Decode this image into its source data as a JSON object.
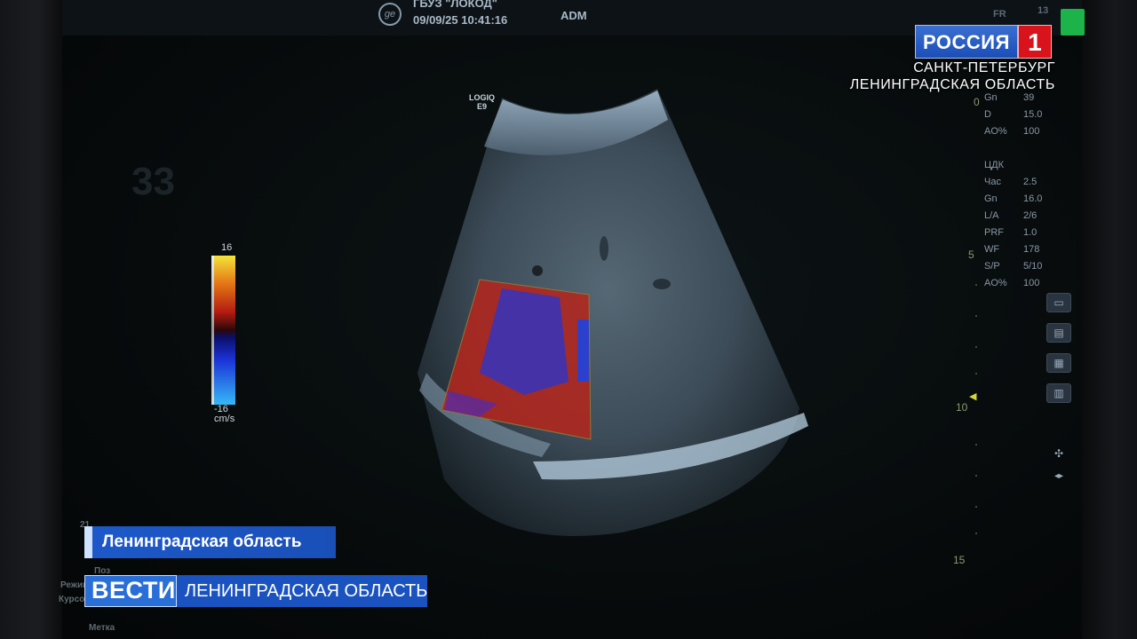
{
  "screen_header": {
    "facility": "ГБУЗ \"ЛОКОД\"",
    "datetime": "09/09/25 10:41:16",
    "user": "ADM",
    "logo_icon": "ge-logo-icon"
  },
  "probe": {
    "line1": "LOGIQ",
    "line2": "E9"
  },
  "ghost_number": "33",
  "color_scale": {
    "max": "16",
    "min": "-16",
    "unit": "cm/s"
  },
  "params_top": [
    {
      "k": "Gn",
      "v": "39"
    },
    {
      "k": "D",
      "v": "15.0"
    },
    {
      "k": "AO%",
      "v": "100"
    }
  ],
  "params_cdk": {
    "title": "ЦДК",
    "rows": [
      {
        "k": "Час",
        "v": "2.5"
      },
      {
        "k": "Gn",
        "v": "16.0"
      },
      {
        "k": "L/A",
        "v": "2/6"
      },
      {
        "k": "PRF",
        "v": "1.0"
      },
      {
        "k": "WF",
        "v": "178"
      },
      {
        "k": "S/P",
        "v": "5/10"
      },
      {
        "k": "AO%",
        "v": "100"
      }
    ]
  },
  "top_right_faint": {
    "f1": "FR",
    "f2": "13"
  },
  "depth_marks": {
    "d0": "0",
    "d5": "5",
    "d10": "10",
    "d15": "15"
  },
  "screen_footer": {
    "r1": "21",
    "r2": "Режим",
    "r3": "Курсор",
    "r4": "Поз",
    "r5": "Метка"
  },
  "broadcast": {
    "channel": "РОССИЯ",
    "channel_num": "1",
    "region_line1": "САНКТ-ПЕТЕРБУРГ",
    "region_line2": "ЛЕНИНГРАДСКАЯ ОБЛАСТЬ",
    "location": "Ленинградская область",
    "program": "ВЕСТИ",
    "program_region": "ЛЕНИНГРАДСКАЯ ОБЛАСТЬ"
  },
  "colors": {
    "doppler_red": "#b3261e",
    "doppler_blue": "#2d35c8",
    "brand_blue": "#1a53bf",
    "brand_red": "#d8131c",
    "indicator_green": "#1bb34a"
  }
}
